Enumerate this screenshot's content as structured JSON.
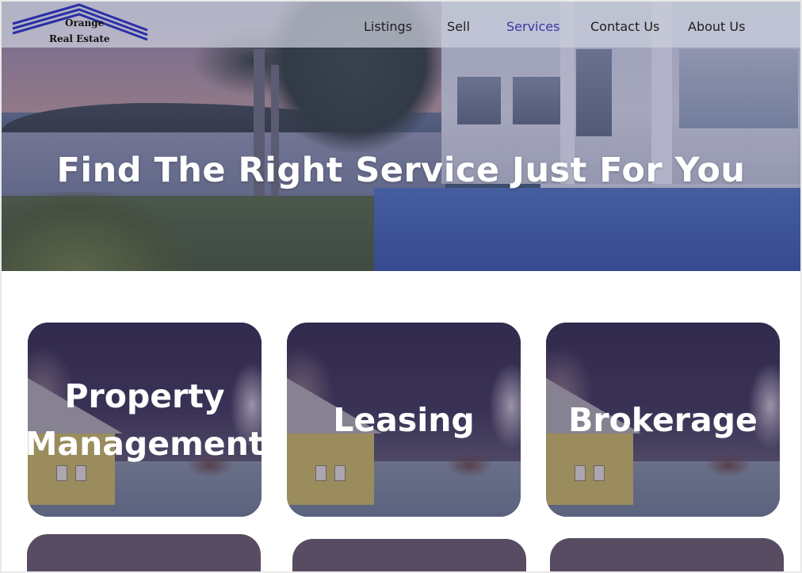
{
  "brand": {
    "line1": "Orange",
    "line2": "Real Estate"
  },
  "nav": {
    "items": [
      {
        "label": "Listings"
      },
      {
        "label": "Sell"
      },
      {
        "label": "Services",
        "active": true
      },
      {
        "label": "Contact Us"
      },
      {
        "label": "About Us"
      }
    ]
  },
  "hero": {
    "title": "Find The Right Service Just For You"
  },
  "services": {
    "cards": [
      {
        "title": "Property Management"
      },
      {
        "title": "Leasing"
      },
      {
        "title": "Brokerage"
      }
    ]
  },
  "colors": {
    "nav_active": "#3c34a8",
    "logo_stripes": "#2a2fa6",
    "card_lower_row": "#574c61"
  }
}
